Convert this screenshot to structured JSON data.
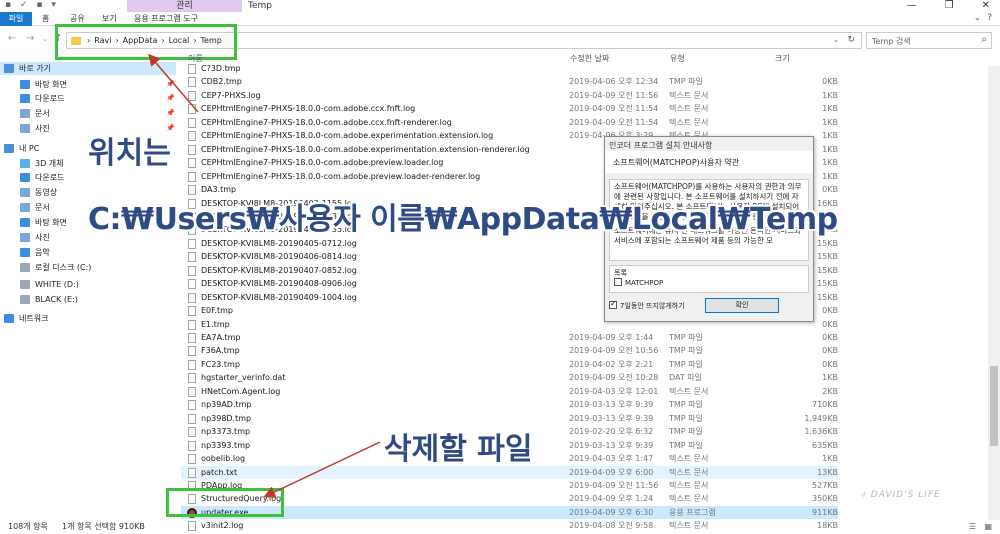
{
  "titlebar": {
    "management_tab": "관리",
    "window_title": "Temp",
    "controls": [
      "—",
      "❐",
      "✕"
    ]
  },
  "ribbon": {
    "tabs": [
      "파일",
      "홈",
      "공유",
      "보기",
      "응용 프로그램 도구"
    ]
  },
  "address": {
    "crumbs": [
      "Ravi",
      "AppData",
      "Local",
      "Temp"
    ],
    "search_placeholder": "Temp 검색"
  },
  "columns": {
    "name": "이름",
    "date": "수정한 날짜",
    "type": "유형",
    "size": "크기"
  },
  "nav": [
    {
      "label": "바로 가기",
      "color": "#4a90d9",
      "pinned": false,
      "level": 0
    },
    {
      "label": "바탕 화면",
      "color": "#3b8ee0",
      "pinned": true,
      "level": 1
    },
    {
      "label": "다운로드",
      "color": "#3b8ee0",
      "pinned": true,
      "level": 1
    },
    {
      "label": "문서",
      "color": "#7aa7d6",
      "pinned": true,
      "level": 1
    },
    {
      "label": "사진",
      "color": "#7aa7d6",
      "pinned": true,
      "level": 1
    },
    {
      "label": "내 PC",
      "color": "#4a90d9",
      "pinned": false,
      "level": 0
    },
    {
      "label": "3D 개체",
      "color": "#5bb0e8",
      "pinned": false,
      "level": 1
    },
    {
      "label": "다운로드",
      "color": "#3b8ee0",
      "pinned": false,
      "level": 1
    },
    {
      "label": "동영상",
      "color": "#7aa7d6",
      "pinned": false,
      "level": 1
    },
    {
      "label": "문서",
      "color": "#7aa7d6",
      "pinned": false,
      "level": 1
    },
    {
      "label": "바탕 화면",
      "color": "#3b8ee0",
      "pinned": false,
      "level": 1
    },
    {
      "label": "사진",
      "color": "#7aa7d6",
      "pinned": false,
      "level": 1
    },
    {
      "label": "음악",
      "color": "#3b8ee0",
      "pinned": false,
      "level": 1
    },
    {
      "label": "로컬 디스크 (C:)",
      "color": "#9aa8b5",
      "pinned": false,
      "level": 1
    },
    {
      "label": "WHITE (D:)",
      "color": "#9aa8b5",
      "pinned": false,
      "level": 1
    },
    {
      "label": "BLACK (E:)",
      "color": "#9aa8b5",
      "pinned": false,
      "level": 1
    },
    {
      "label": "네트워크",
      "color": "#3b8ee0",
      "pinned": false,
      "level": 0
    }
  ],
  "files": [
    {
      "name": "C?3D.tmp",
      "date": "",
      "type": "",
      "size": ""
    },
    {
      "name": "CDB2.tmp",
      "date": "2019-04-06 오후 12:34",
      "type": "TMP 파일",
      "size": "0KB"
    },
    {
      "name": "CEP7-PHXS.log",
      "date": "2019-04-09 오전 11:56",
      "type": "텍스트 문서",
      "size": "1KB"
    },
    {
      "name": "CEPHtmlEngine7-PHXS-18.0.0-com.adobe.ccx.fnft.log",
      "date": "2019-04-09 오전 11:54",
      "type": "텍스트 문서",
      "size": "1KB"
    },
    {
      "name": "CEPHtmlEngine7-PHXS-18.0.0-com.adobe.ccx.fnft-renderer.log",
      "date": "2019-04-09 오전 11:54",
      "type": "텍스트 문서",
      "size": "1KB"
    },
    {
      "name": "CEPHtmlEngine7-PHXS-18.0.0-com.adobe.experimentation.extension.log",
      "date": "2019-04-06 오후 3:29",
      "type": "텍스트 문서",
      "size": "1KB"
    },
    {
      "name": "CEPHtmlEngine7-PHXS-18.0.0-com.adobe.experimentation.extension-renderer.log",
      "date": "",
      "type": "",
      "size": "1KB"
    },
    {
      "name": "CEPHtmlEngine7-PHXS-18.0.0-com.adobe.preview.loader.log",
      "date": "",
      "type": "",
      "size": "1KB"
    },
    {
      "name": "CEPHtmlEngine7-PHXS-18.0.0-com.adobe.preview.loader-renderer.log",
      "date": "",
      "type": "",
      "size": "1KB"
    },
    {
      "name": "DA3.tmp",
      "date": "",
      "type": "",
      "size": "0KB"
    },
    {
      "name": "DESKTOP-KVI8LM8-20190402-1155.log",
      "date": "",
      "type": "",
      "size": "16KB"
    },
    {
      "name": "DESKTOP-KVI8LM8-20190403-0735.log",
      "date": "",
      "type": "",
      "size": "15KB"
    },
    {
      "name": "DESKTOP-KVI8LM8-20190404-0735.log",
      "date": "",
      "type": "",
      "size": "38KB"
    },
    {
      "name": "DESKTOP-KVI8LM8-20190405-0712.log",
      "date": "",
      "type": "",
      "size": "15KB"
    },
    {
      "name": "DESKTOP-KVI8LM8-20190406-0814.log",
      "date": "",
      "type": "",
      "size": "15KB"
    },
    {
      "name": "DESKTOP-KVI8LM8-20190407-0852.log",
      "date": "",
      "type": "",
      "size": "15KB"
    },
    {
      "name": "DESKTOP-KVI8LM8-20190408-0906.log",
      "date": "",
      "type": "",
      "size": "15KB"
    },
    {
      "name": "DESKTOP-KVI8LM8-20190409-1004.log",
      "date": "",
      "type": "",
      "size": "15KB"
    },
    {
      "name": "E0F.tmp",
      "date": "",
      "type": "",
      "size": "0KB"
    },
    {
      "name": "E1.tmp",
      "date": "",
      "type": "",
      "size": "0KB"
    },
    {
      "name": "EA7A.tmp",
      "date": "2019-04-09 오후 1:44",
      "type": "TMP 파일",
      "size": "0KB"
    },
    {
      "name": "F36A.tmp",
      "date": "2019-04-09 오전 10:56",
      "type": "TMP 파일",
      "size": "0KB"
    },
    {
      "name": "FC23.tmp",
      "date": "2019-04-02 오후 2:21",
      "type": "TMP 파일",
      "size": "0KB"
    },
    {
      "name": "hgstarter_verinfo.dat",
      "date": "2019-04-09 오전 10:28",
      "type": "DAT 파일",
      "size": "1KB"
    },
    {
      "name": "HNetCom.Agent.log",
      "date": "2019-04-03 오후 12:01",
      "type": "텍스트 문서",
      "size": "2KB"
    },
    {
      "name": "np39AD.tmp",
      "date": "2019-03-13 오후 9:39",
      "type": "TMP 파일",
      "size": "710KB"
    },
    {
      "name": "np398D.tmp",
      "date": "2019-03-13 오후 9:39",
      "type": "TMP 파일",
      "size": "1,949KB"
    },
    {
      "name": "np3373.tmp",
      "date": "2019-02-20 오후 6:32",
      "type": "TMP 파일",
      "size": "1,636KB"
    },
    {
      "name": "np3393.tmp",
      "date": "2019-03-13 오후 9:39",
      "type": "TMP 파일",
      "size": "635KB"
    },
    {
      "name": "oobelib.log",
      "date": "2019-04-03 오후 1:47",
      "type": "텍스트 문서",
      "size": "1KB"
    },
    {
      "name": "patch.txt",
      "date": "2019-04-09 오후 6:00",
      "type": "텍스트 문서",
      "size": "13KB"
    },
    {
      "name": "PDApp.log",
      "date": "2019-04-09 오전 11:56",
      "type": "텍스트 문서",
      "size": "527KB"
    },
    {
      "name": "StructuredQuery.log",
      "date": "2019-04-09 오후 1:24",
      "type": "텍스트 문서",
      "size": "350KB"
    },
    {
      "name": "updater.exe",
      "date": "2019-04-09 오후 6:30",
      "type": "응용 프로그램",
      "size": "911KB"
    },
    {
      "name": "v3init2.log",
      "date": "2019-04-08 오전 9:58",
      "type": "텍스트 문서",
      "size": "18KB"
    }
  ],
  "dialog": {
    "title": "인코더 프로그램 설치 안내사항",
    "heading": "소프트웨어(MATCHPOP)사용자 약관",
    "body1": "소프트웨어(MATCHPOP)를 사용하는 사용자의 권한과 의무에 관련된 사항입니다. 본 소프트웨어를 설치하시기 전에 자세히 읽어주십시오. 본 소프트웨어는 사용자 PC에 설치되어 프로그램을 제공합니다. 소프트웨어 이용 시 준수",
    "body2": "소프트웨어에는 유/무선 네트워크를 이용한 온라인 서비스와 서비스에 포함되는 소프트웨어 제품 등의 가능한 모",
    "list_header": "목록",
    "list_item": "MATCHPOP",
    "footer_check": "7일동안 뜨지않게하기",
    "ok": "확인"
  },
  "status": {
    "count": "108개 항목",
    "selected": "1개 항목 선택함 910KB"
  },
  "annotations": {
    "location_label": "위치는",
    "path": "C:₩Users₩사용자 이름₩AppData₩Local₩Temp",
    "delete_label": "삭제할 파일"
  },
  "colors": {
    "accent": "#1979ca",
    "highlight": "#3fc03f",
    "annotation": "#2f4a85",
    "arrow": "#c0392b"
  }
}
